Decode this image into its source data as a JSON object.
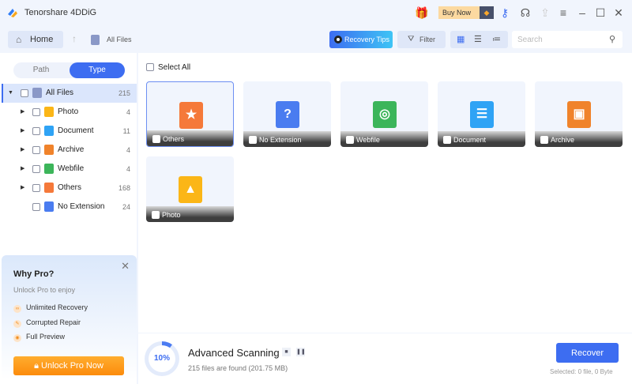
{
  "app": {
    "title": "Tenorshare 4DDiG",
    "buy_now": "Buy Now"
  },
  "toolbar": {
    "home": "Home",
    "breadcrumb": "All Files",
    "recovery_tips": "Recovery Tips",
    "filter": "Filter",
    "search_placeholder": "Search"
  },
  "sidebar": {
    "tabs": {
      "path": "Path",
      "type": "Type",
      "active": "Type"
    },
    "root": {
      "label": "All Files",
      "count": "215"
    },
    "items": [
      {
        "label": "Photo",
        "count": "4",
        "color": "#fbb617",
        "icon": "photo-icon"
      },
      {
        "label": "Document",
        "count": "11",
        "color": "#2fa3f5",
        "icon": "document-icon"
      },
      {
        "label": "Archive",
        "count": "4",
        "color": "#f0832b",
        "icon": "archive-icon"
      },
      {
        "label": "Webfile",
        "count": "4",
        "color": "#3cb55a",
        "icon": "webfile-icon"
      },
      {
        "label": "Others",
        "count": "168",
        "color": "#f5793a",
        "icon": "star-file-icon"
      },
      {
        "label": "No Extension",
        "count": "24",
        "color": "#4a7cf0",
        "icon": "question-file-icon"
      }
    ]
  },
  "main": {
    "select_all": "Select All",
    "cards": [
      {
        "label": "Others",
        "color": "#f5793a",
        "glyph": "★"
      },
      {
        "label": "No Extension",
        "color": "#4a7cf0",
        "glyph": "?"
      },
      {
        "label": "Webfile",
        "color": "#3cb55a",
        "glyph": "◎"
      },
      {
        "label": "Document",
        "color": "#2fa3f5",
        "glyph": "☰"
      },
      {
        "label": "Archive",
        "color": "#f0832b",
        "glyph": "▣"
      },
      {
        "label": "Photo",
        "color": "#fbb617",
        "glyph": "▲"
      }
    ]
  },
  "pro": {
    "title": "Why Pro?",
    "subtitle": "Unlock Pro to enjoy",
    "features": [
      "Unlimited Recovery",
      "Corrupted Repair",
      "Full Preview"
    ],
    "button": "Unlock Pro Now"
  },
  "scan": {
    "progress": "10%",
    "title": "Advanced Scanning",
    "found": "215 files are found (201.75 MB)",
    "recover": "Recover",
    "selected": "Selected: 0 file, 0 Byte"
  }
}
